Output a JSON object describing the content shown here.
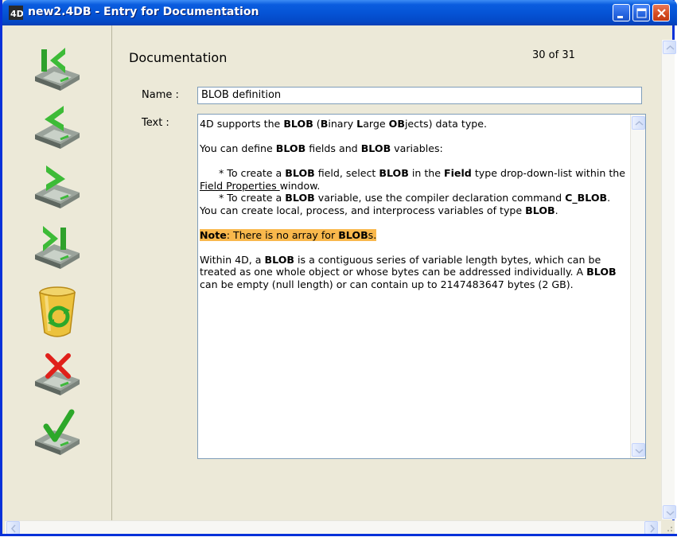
{
  "window": {
    "title": "new2.4DB - Entry for Documentation",
    "colors": {
      "titlebar": "#0554d6",
      "frame": "#ece9d8",
      "highlight": "#f9b84c",
      "close": "#d3491e"
    }
  },
  "toolbar": [
    {
      "icon": "first-record-icon"
    },
    {
      "icon": "previous-record-icon"
    },
    {
      "icon": "next-record-icon"
    },
    {
      "icon": "last-record-icon"
    },
    {
      "icon": "recycle-bin-icon"
    },
    {
      "icon": "delete-record-icon"
    },
    {
      "icon": "accept-record-icon"
    }
  ],
  "form": {
    "heading": "Documentation",
    "counter": "30 of 31",
    "name_label": "Name :",
    "name_value": "BLOB definition",
    "text_label": "Text :"
  },
  "text": {
    "p1": {
      "a": "4D supports the ",
      "b1": "BLOB",
      "c": " (",
      "b2": "B",
      "d": "inary ",
      "b3": "L",
      "e": "arge ",
      "b4": "OB",
      "f": "jects) data type."
    },
    "p2": {
      "a": "You can define ",
      "b1": "BLOB",
      "c": " fields and ",
      "b2": "BLOB",
      "d": " variables:"
    },
    "p3": {
      "a": "* To create a ",
      "b1": "BLOB",
      "c": " field, select ",
      "b2": "BLOB",
      "d": " in the ",
      "b3": "Field",
      "e": " type drop-down-list within the ",
      "link": "Field Properties ",
      "f": "window."
    },
    "p4": {
      "a": "* To create a ",
      "b1": "BLOB",
      "c": " variable, use the compiler declaration command ",
      "b2": "C_BLOB",
      "d": ". You can create local, process, and interprocess variables of type ",
      "b3": "BLOB",
      "e": "."
    },
    "p5": {
      "b1": "Note",
      "a": ": There is no array for ",
      "b2": "BLOB",
      "c": "s."
    },
    "p6": {
      "a": "Within 4D, a ",
      "b1": "BLOB",
      "c": " is a contiguous series of variable length bytes, which can be treated as one whole object or whose bytes can be addressed individually. A ",
      "b2": "BLOB",
      "d": " can be empty (null length) or can contain up to 2147483647 bytes (2 GB)."
    }
  }
}
